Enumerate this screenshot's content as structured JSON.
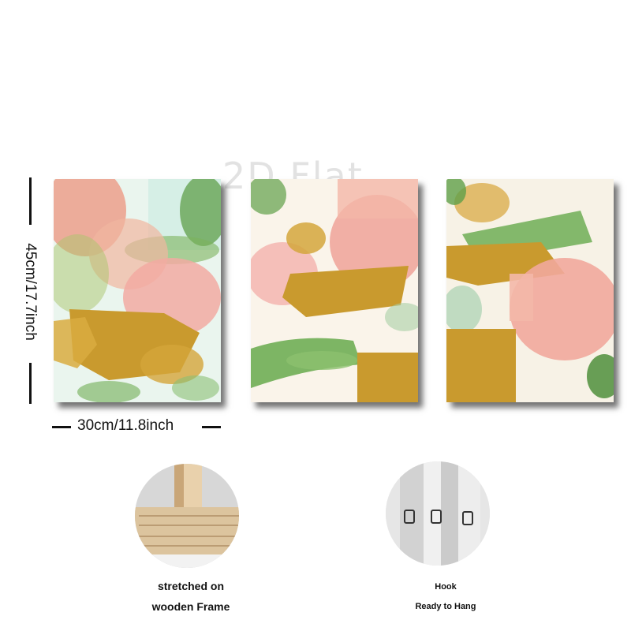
{
  "watermark": "2D Flat",
  "dimensions": {
    "height_label": "45cm/17.7inch",
    "width_label": "30cm/11.8inch"
  },
  "panels": [
    {
      "name": "abstract-panel-left"
    },
    {
      "name": "abstract-panel-middle"
    },
    {
      "name": "abstract-panel-right"
    }
  ],
  "features": {
    "frame_caption_line1": "stretched on",
    "frame_caption_line2": "wooden Frame",
    "hook_caption_line1": "Hook",
    "hook_caption_line2": "Ready to Hang"
  },
  "colors": {
    "gold": "#c99a2e",
    "pink": "#f1a99c",
    "green": "#6fae55",
    "cream": "#f6f1e8",
    "mint": "#d6efe6"
  }
}
